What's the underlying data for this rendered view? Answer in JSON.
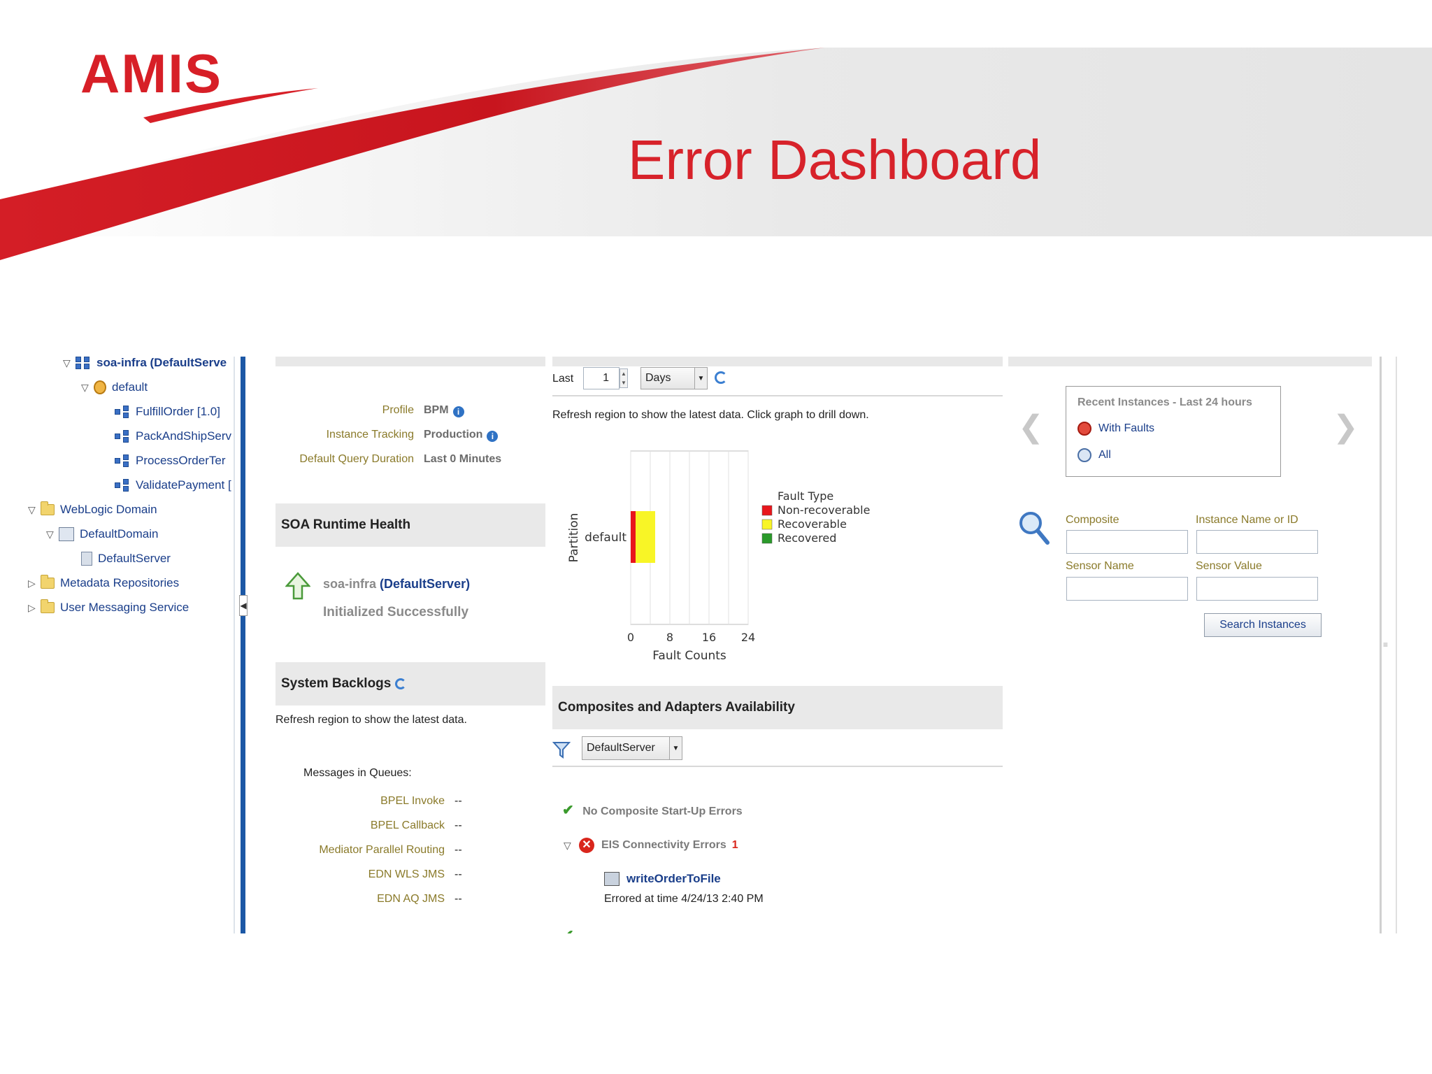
{
  "slide": {
    "logo_text": "AMIS",
    "title": "Error Dashboard"
  },
  "colors": {
    "brand_red": "#d7222a",
    "link_navy": "#1a3e8a",
    "label_olive": "#8a7a2a",
    "non_recoverable": "#e8161c",
    "recoverable": "#f8f526",
    "recovered": "#2a9a2a"
  },
  "tree": {
    "items": [
      {
        "label": "soa-infra (DefaultServe",
        "icon": "soa-infra-icon",
        "toggle": "▽",
        "bold": true
      },
      {
        "label": "default",
        "icon": "partition-icon",
        "toggle": "▽"
      },
      {
        "label": "FulfillOrder [1.0]",
        "icon": "composite-icon",
        "toggle": ""
      },
      {
        "label": "PackAndShipServ",
        "icon": "composite-icon",
        "toggle": ""
      },
      {
        "label": "ProcessOrderTer",
        "icon": "composite-icon",
        "toggle": ""
      },
      {
        "label": "ValidatePayment [",
        "icon": "composite-icon",
        "toggle": ""
      },
      {
        "label": "WebLogic Domain",
        "icon": "folder-icon",
        "toggle": "▽"
      },
      {
        "label": "DefaultDomain",
        "icon": "domain-icon",
        "toggle": "▽"
      },
      {
        "label": "DefaultServer",
        "icon": "server-icon",
        "toggle": ""
      },
      {
        "label": "Metadata Repositories",
        "icon": "folder-icon",
        "toggle": "▷"
      },
      {
        "label": "User Messaging Service",
        "icon": "folder-icon",
        "toggle": "▷"
      }
    ]
  },
  "info": {
    "profile_label": "Profile",
    "profile_value": "BPM",
    "tracking_label": "Instance Tracking",
    "tracking_value": "Production",
    "duration_label": "Default Query Duration",
    "duration_value": "Last 0 Minutes"
  },
  "health": {
    "title": "SOA Runtime Health",
    "server_prefix": "soa-infra ",
    "server_name": "(DefaultServer)",
    "status": "Initialized Successfully"
  },
  "backlogs": {
    "title": "System Backlogs",
    "refresh_note": "Refresh region to show the latest data.",
    "queues_label": "Messages in Queues:",
    "rows": [
      {
        "label": "BPEL Invoke",
        "value": "--"
      },
      {
        "label": "BPEL Callback",
        "value": "--"
      },
      {
        "label": "Mediator Parallel Routing",
        "value": "--"
      },
      {
        "label": "EDN WLS JMS",
        "value": "--"
      },
      {
        "label": "EDN AQ JMS",
        "value": "--"
      }
    ]
  },
  "faults": {
    "last_label": "Last",
    "last_value": "1",
    "unit": "Days",
    "refresh_note": "Refresh region to show the latest data. Click graph to drill down."
  },
  "chart_data": {
    "type": "bar",
    "orientation": "horizontal",
    "stacked": true,
    "categories": [
      "default"
    ],
    "series": [
      {
        "name": "Non-recoverable",
        "values": [
          1
        ],
        "color": "#e8161c"
      },
      {
        "name": "Recoverable",
        "values": [
          4
        ],
        "color": "#f8f526"
      },
      {
        "name": "Recovered",
        "values": [
          0
        ],
        "color": "#2a9a2a"
      }
    ],
    "xlabel": "Fault Counts",
    "ylabel": "Partition",
    "xlim": [
      0,
      24
    ],
    "xticks": [
      "0",
      "8",
      "16",
      "24"
    ],
    "legend_title": "Fault Type",
    "legend_position": "right",
    "grid": true
  },
  "availability": {
    "title": "Composites and Adapters Availability",
    "server_select": "DefaultServer",
    "no_startup_errors": "No Composite Start-Up Errors",
    "eis_errors_label": "EIS Connectivity Errors",
    "eis_errors_count": "1",
    "error_item_name": "writeOrderToFile",
    "error_item_time": "Errored at time 4/24/13 2:40 PM"
  },
  "recent": {
    "title": "Recent Instances - Last 24 hours",
    "with_faults": "With Faults",
    "all": "All",
    "prev_arrow": "❮",
    "next_arrow": "❯"
  },
  "search": {
    "composite_label": "Composite",
    "instance_label": "Instance Name or ID",
    "sensor_name_label": "Sensor Name",
    "sensor_value_label": "Sensor Value",
    "button_label": "Search Instances"
  }
}
